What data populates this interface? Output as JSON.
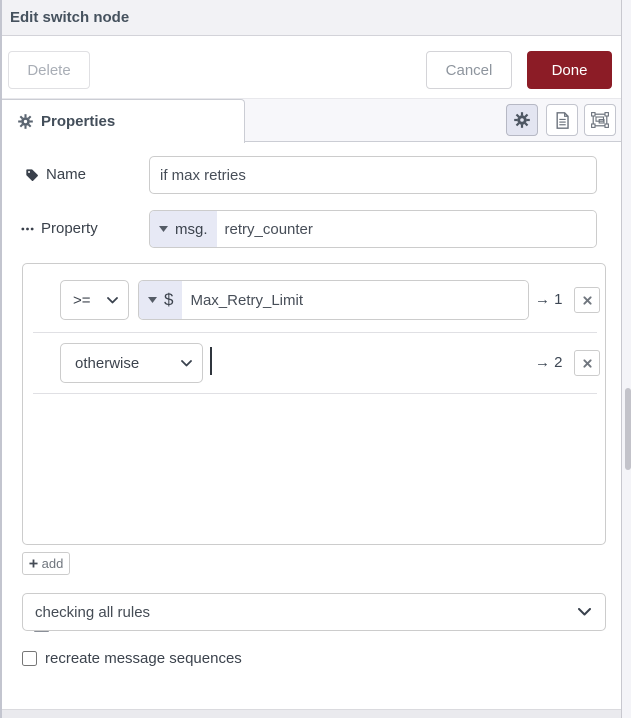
{
  "header": {
    "title": "Edit switch node"
  },
  "actions": {
    "delete": "Delete",
    "cancel": "Cancel",
    "done": "Done"
  },
  "tabs": {
    "properties": "Properties"
  },
  "fields": {
    "name": {
      "label": "Name",
      "value": "if max retries"
    },
    "property": {
      "label": "Property",
      "type_prefix": "msg.",
      "value": "retry_counter"
    }
  },
  "rules": [
    {
      "operator": ">=",
      "type_prefix": "$",
      "value": "Max_Retry_Limit",
      "output": "→ 1"
    },
    {
      "operator": "otherwise",
      "value": "",
      "output": "→ 2"
    }
  ],
  "add_button_label": "add",
  "mode_select": {
    "value": "checking all rules"
  },
  "recreate_checkbox": {
    "label": "recreate message sequences",
    "checked": false
  },
  "icons": {
    "tab": "gear-icon",
    "name_field": "tag-icon",
    "property_field": "ellipsis-icon",
    "toolbar": [
      "gear-icon",
      "document-icon",
      "object-group-icon"
    ],
    "rule_handle": "grip-icon",
    "rule_remove": "x-icon",
    "add": "plus-icon",
    "selects": "chevron-down-icon",
    "typed_input": "caret-down-icon"
  },
  "colors": {
    "primary_button_bg": "#8C1C26",
    "type_prefix_bg": "#e7e9f5",
    "header_bg": "#f2f2f5",
    "input_border": "#cccccc",
    "dark_text": "#3d4754"
  }
}
